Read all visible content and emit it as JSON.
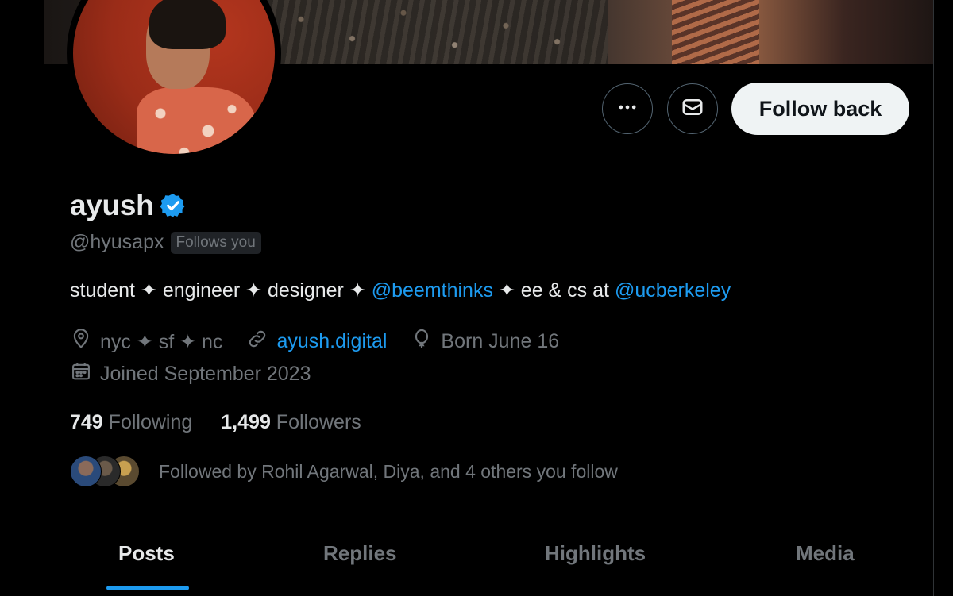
{
  "profile": {
    "display_name": "ayush",
    "handle": "@hyusapx",
    "follows_you_badge": "Follows you",
    "verified": true
  },
  "actions": {
    "more_icon": "more-horizontal-icon",
    "message_icon": "envelope-icon",
    "follow_back_label": "Follow back"
  },
  "bio": {
    "parts": [
      {
        "type": "text",
        "text": "student ✦ engineer ✦ designer ✦ "
      },
      {
        "type": "mention",
        "text": "@beemthinks"
      },
      {
        "type": "text",
        "text": " ✦ ee & cs at "
      },
      {
        "type": "mention",
        "text": "@ucberkeley"
      }
    ]
  },
  "meta": {
    "location": "nyc ✦ sf ✦ nc",
    "website": "ayush.digital",
    "birthday": "Born June 16",
    "joined": "Joined September 2023"
  },
  "stats": {
    "following_count": "749",
    "following_label": "Following",
    "followers_count": "1,499",
    "followers_label": "Followers"
  },
  "followed_by": {
    "text": "Followed by Rohil Agarwal, Diya, and 4 others you follow"
  },
  "tabs": [
    {
      "label": "Posts",
      "active": true
    },
    {
      "label": "Replies",
      "active": false
    },
    {
      "label": "Highlights",
      "active": false
    },
    {
      "label": "Media",
      "active": false
    }
  ],
  "colors": {
    "background": "#000000",
    "text_primary": "#e7e9ea",
    "text_secondary": "#71767b",
    "accent": "#1d9bf0",
    "button_light": "#eff3f4"
  }
}
